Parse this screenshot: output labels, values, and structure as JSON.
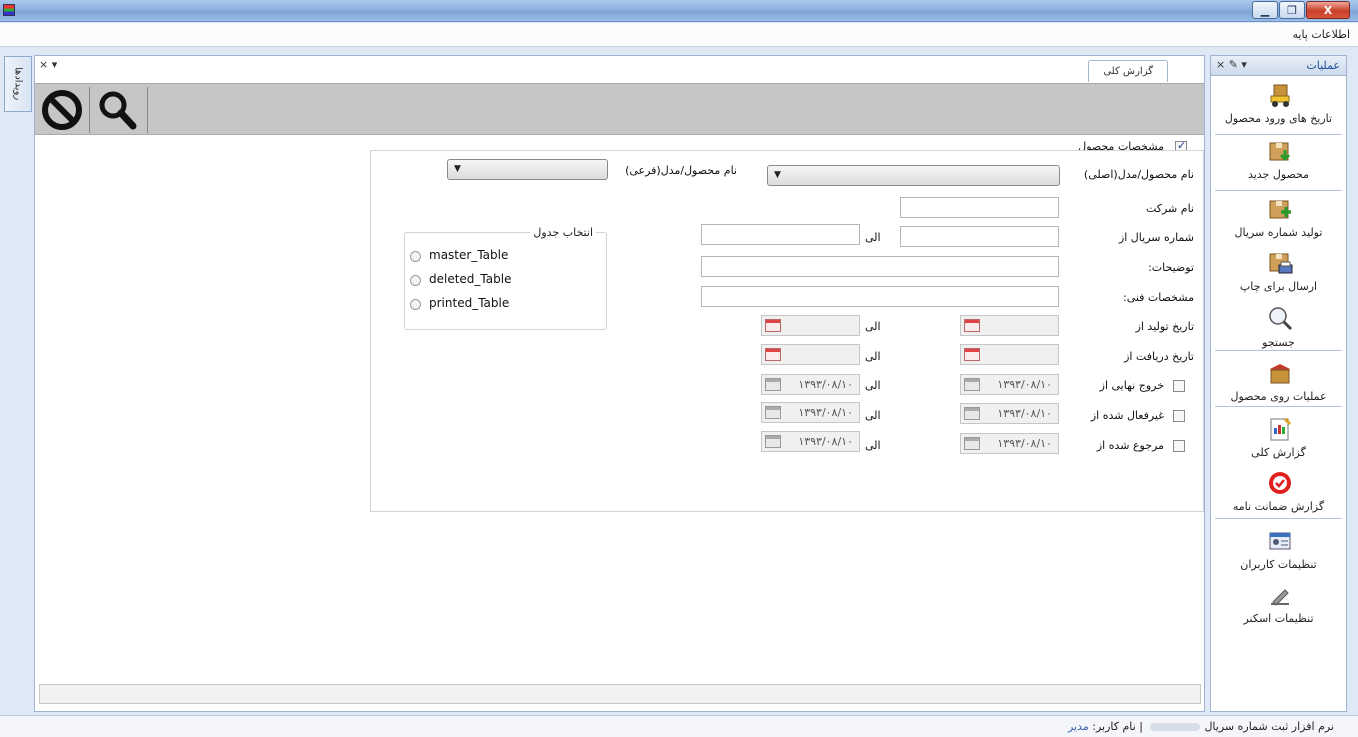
{
  "window": {
    "minimize": "▁",
    "maximize": "❐",
    "close": "X"
  },
  "menu": {
    "item": "اطلاعات پایه"
  },
  "left_strip": {
    "label": "رویدادها"
  },
  "main": {
    "tools": "× ▾",
    "tab": "گزارش کلی",
    "section_title": "مشخصات محصول",
    "labels": {
      "product_main": "نام محصول/مدل(اصلی)",
      "product_sub": "نام محصول/مدل(فرعی)",
      "company": "نام شرکت",
      "serial_from": "شماره سریال از",
      "description": "توضیحات:",
      "tech_spec": "مشخصات فنی:",
      "production_date": "تاریخ تولید از",
      "receive_date": "تاریخ دریافت از",
      "final_exit": "خروج نهایی از",
      "deactivated": "غیرفعال شده از",
      "returned": "مرجوع شده از",
      "to": "الی"
    },
    "dates": {
      "final_exit_from": "۱۳۹۳/۰۸/۱۰",
      "final_exit_to": "۱۳۹۳/۰۸/۱۰",
      "deactivated_from": "۱۳۹۳/۰۸/۱۰",
      "deactivated_to": "۱۳۹۳/۰۸/۱۰",
      "returned_from": "۱۳۹۳/۰۸/۱۰",
      "returned_to": "۱۳۹۳/۰۸/۱۰"
    },
    "table_select": {
      "legend": "انتخاب جدول",
      "options": [
        "master_Table",
        "deleted_Table",
        "printed_Table"
      ]
    }
  },
  "side": {
    "title": "عملیات",
    "tools": "× ✎ ▾",
    "items": [
      {
        "label": "تاریخ های ورود محصول",
        "icon": "forklift-box-icon"
      },
      {
        "label": "محصول جدید",
        "icon": "box-download-icon"
      },
      {
        "label": "تولید شماره سریال",
        "icon": "box-add-icon"
      },
      {
        "label": "ارسال برای چاپ",
        "icon": "box-print-icon"
      },
      {
        "label": "جستجو",
        "icon": "magnifier-icon"
      },
      {
        "label": "عملیات روی محصول",
        "icon": "open-box-icon"
      },
      {
        "label": "گزارش کلی",
        "icon": "report-icon"
      },
      {
        "label": "گزارش ضمانت نامه",
        "icon": "warranty-badge-icon"
      },
      {
        "label": "تنظیمات کاربران",
        "icon": "user-card-icon"
      },
      {
        "label": "تنظیمات اسکنر",
        "icon": "scanner-icon"
      }
    ]
  },
  "status": {
    "app": "نرم افزار ثبت شماره سریال",
    "separator": "|",
    "user_label": "نام کاربر:",
    "user_value": "مدیر"
  }
}
